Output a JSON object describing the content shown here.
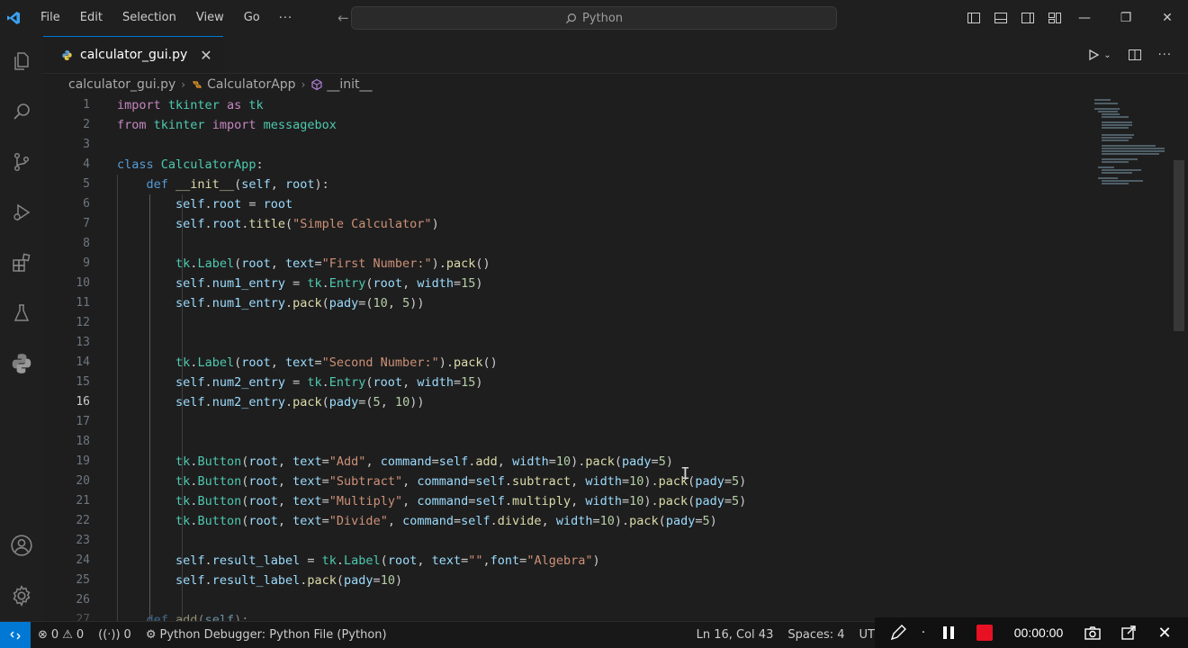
{
  "titlebar": {
    "menu": [
      "File",
      "Edit",
      "Selection",
      "View",
      "Go"
    ],
    "more": "···",
    "search_text": "Python"
  },
  "tab": {
    "filename": "calculator_gui.py",
    "close": "✕"
  },
  "breadcrumbs": {
    "file": "calculator_gui.py",
    "class": "CalculatorApp",
    "method": "__init__"
  },
  "editor": {
    "active_line": 16,
    "lines": [
      {
        "n": "1",
        "y": 0
      },
      {
        "n": "2",
        "y": 1
      },
      {
        "n": "3",
        "y": 2
      },
      {
        "n": "4",
        "y": 3
      },
      {
        "n": "5",
        "y": 4
      },
      {
        "n": "6",
        "y": 5
      },
      {
        "n": "7",
        "y": 6
      },
      {
        "n": "8",
        "y": 7
      },
      {
        "n": "9",
        "y": 8
      },
      {
        "n": "10",
        "y": 9
      },
      {
        "n": "11",
        "y": 10
      },
      {
        "n": "12",
        "y": 11
      },
      {
        "n": "13",
        "y": 12
      },
      {
        "n": "14",
        "y": 13
      },
      {
        "n": "15",
        "y": 14
      },
      {
        "n": "16",
        "y": 15
      },
      {
        "n": "17",
        "y": 16
      },
      {
        "n": "18",
        "y": 17
      },
      {
        "n": "19",
        "y": 18
      },
      {
        "n": "20",
        "y": 19
      },
      {
        "n": "21",
        "y": 20
      },
      {
        "n": "22",
        "y": 21
      },
      {
        "n": "23",
        "y": 22
      },
      {
        "n": "24",
        "y": 23
      },
      {
        "n": "25",
        "y": 24
      },
      {
        "n": "26",
        "y": 25
      },
      {
        "n": "27",
        "y": 26
      }
    ],
    "partial_line": "def add(self):"
  },
  "statusbar": {
    "errors": "0",
    "warnings": "0",
    "ports": "0",
    "debugger": "Python Debugger: Python File (Python)",
    "position": "Ln 16, Col 43",
    "spaces": "Spaces: 4",
    "encoding": "UT"
  },
  "recorder": {
    "time": "00:00:00"
  },
  "colors": {
    "accent": "#0078d4",
    "record": "#e81123"
  }
}
